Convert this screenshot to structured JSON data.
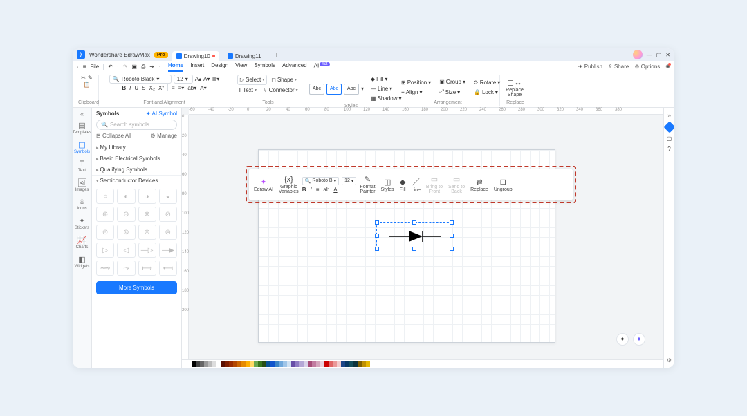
{
  "titlebar": {
    "app": "Wondershare EdrawMax",
    "pro": "Pro",
    "tab1": "Drawing10",
    "tab2": "Drawing11"
  },
  "quick": {
    "file": "File"
  },
  "menu": {
    "home": "Home",
    "insert": "Insert",
    "design": "Design",
    "view": "View",
    "symbols": "Symbols",
    "advanced": "Advanced",
    "ai": "AI",
    "hot": "hot"
  },
  "topright": {
    "publish": "Publish",
    "share": "Share",
    "options": "Options"
  },
  "ribbon": {
    "clipboard": "Clipboard",
    "font_align": "Font and Alignment",
    "font": "Roboto Black",
    "size": "12",
    "tools": "Tools",
    "select": "Select",
    "shape": "Shape",
    "text": "Text",
    "connector": "Connector",
    "abc": "Abc",
    "styles": "Styles",
    "fill": "Fill",
    "line": "Line",
    "shadow": "Shadow",
    "position": "Position",
    "align": "Align",
    "group": "Group",
    "size_btn": "Size",
    "rotate": "Rotate",
    "lock": "Lock",
    "arrangement": "Arrangement",
    "replace_shape": "Replace\nShape",
    "replace": "Replace"
  },
  "rail": {
    "templates": "Templates",
    "symbols": "Symbols",
    "text": "Text",
    "images": "Images",
    "icons": "Icons",
    "stickers": "Stickers",
    "charts": "Charts",
    "widgets": "Widgets"
  },
  "panel": {
    "title": "Symbols",
    "ai": "AI Symbol",
    "search_ph": "Search symbols",
    "collapse": "Collapse All",
    "manage": "Manage",
    "cat1": "My Library",
    "cat2": "Basic Electrical Symbols",
    "cat3": "Qualifying Symbols",
    "cat4": "Semiconductor Devices",
    "more": "More Symbols"
  },
  "ctx": {
    "edraw_ai": "Edraw AI",
    "graphic_vars": "Graphic\nVariables",
    "font": "Roboto B",
    "size": "12",
    "format_painter": "Format\nPainter",
    "styles": "Styles",
    "fill": "Fill",
    "line": "Line",
    "bring_front": "Bring to\nFront",
    "send_back": "Send to\nBack",
    "replace": "Replace",
    "ungroup": "Ungroup"
  },
  "ruler_h": [
    "-60",
    "-40",
    "-20",
    "0",
    "20",
    "40",
    "60",
    "80",
    "100",
    "120",
    "140",
    "160",
    "180",
    "200",
    "220",
    "240",
    "260",
    "280",
    "300",
    "320",
    "340",
    "360",
    "380"
  ],
  "ruler_v": [
    "0",
    "20",
    "40",
    "60",
    "80",
    "100",
    "120",
    "140",
    "160",
    "180",
    "200"
  ],
  "palette": [
    "#000",
    "#444",
    "#666",
    "#999",
    "#bbb",
    "#ddd",
    "#fff",
    "#5b0f00",
    "#7f1d00",
    "#992c00",
    "#b34700",
    "#cc6600",
    "#e68a00",
    "#ffb000",
    "#ffd966",
    "#6aa84f",
    "#38761d",
    "#274e13",
    "#0b5394",
    "#1155cc",
    "#3d85c6",
    "#6fa8dc",
    "#9fc5e8",
    "#cfe2f3",
    "#674ea7",
    "#8e7cc3",
    "#b4a7d6",
    "#d9d2e9",
    "#a64d79",
    "#c27ba0",
    "#d5a6bd",
    "#ead1dc",
    "#cc0000",
    "#e06666",
    "#ea9999",
    "#f4cccc",
    "#1c4587",
    "#073763",
    "#134f5c",
    "#0c343d",
    "#7f6000",
    "#bf9000",
    "#e6b800"
  ]
}
